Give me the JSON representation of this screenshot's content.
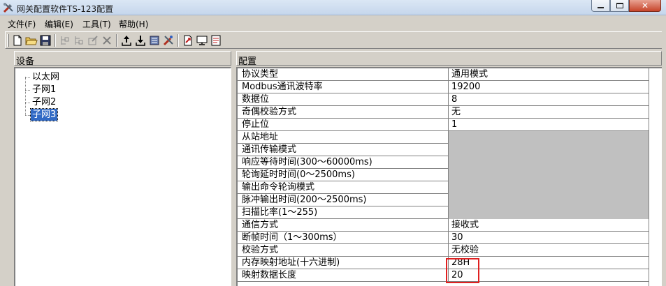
{
  "window": {
    "title": "网关配置软件TS-123配置",
    "icon": "tools-icon"
  },
  "menu": [
    {
      "label": "文件(F)"
    },
    {
      "label": "编辑(E)"
    },
    {
      "label": "工具(T)"
    },
    {
      "label": "帮助(H)"
    }
  ],
  "toolbar": {
    "buttons": [
      "new-file-icon",
      "open-folder-icon",
      "save-icon",
      "add-node-icon",
      "add-child-node-icon",
      "edit-node-icon",
      "delete-icon",
      "upload-icon",
      "download-icon",
      "device-settings-icon",
      "tools-icon",
      "export-icon",
      "monitor-icon",
      "log-icon"
    ]
  },
  "device_panel": {
    "header": "设备",
    "tree": [
      {
        "label": "以太网",
        "selected": false
      },
      {
        "label": "子网1",
        "selected": false
      },
      {
        "label": "子网2",
        "selected": false
      },
      {
        "label": "子网3",
        "selected": true
      }
    ]
  },
  "config_panel": {
    "header": "配置",
    "rows": [
      {
        "name": "协议类型",
        "value": "通用模式",
        "enabled": true
      },
      {
        "name": "Modbus通讯波特率",
        "value": "19200",
        "enabled": true
      },
      {
        "name": "数据位",
        "value": "8",
        "enabled": true
      },
      {
        "name": "奇偶校验方式",
        "value": "无",
        "enabled": true
      },
      {
        "name": "停止位",
        "value": "1",
        "enabled": true
      },
      {
        "name": "从站地址",
        "value": "",
        "enabled": false
      },
      {
        "name": "通讯传输模式",
        "value": "",
        "enabled": false
      },
      {
        "name": "响应等待时间(300～60000ms)",
        "value": "",
        "enabled": false
      },
      {
        "name": "轮询延时时间(0～2500ms)",
        "value": "",
        "enabled": false
      },
      {
        "name": "输出命令轮询模式",
        "value": "",
        "enabled": false
      },
      {
        "name": "脉冲输出时间(200～2500ms)",
        "value": "",
        "enabled": false
      },
      {
        "name": "扫描比率(1～255)",
        "value": "",
        "enabled": false
      },
      {
        "name": "通信方式",
        "value": "接收式",
        "enabled": true
      },
      {
        "name": "断帧时间（1～300ms）",
        "value": "30",
        "enabled": true
      },
      {
        "name": "校验方式",
        "value": "无校验",
        "enabled": true
      },
      {
        "name": "内存映射地址(十六进制)",
        "value": "28H",
        "enabled": true
      },
      {
        "name": "映射数据长度",
        "value": "20",
        "enabled": true
      }
    ]
  },
  "colors": {
    "selection": "#316ac5",
    "highlight_box": "#e02020",
    "disabled_cell": "#c0c0c0"
  }
}
